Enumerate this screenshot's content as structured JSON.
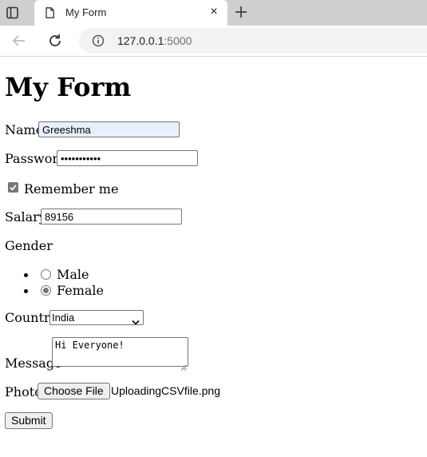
{
  "browser": {
    "tab_title": "My Form",
    "close_glyph": "×",
    "url_host": "127.0.0.1",
    "url_port": ":5000"
  },
  "form": {
    "heading": "My Form",
    "name_label": "Name",
    "name_value": "Greeshma",
    "password_label": "Password",
    "password_value": "•••••••••••",
    "remember_label": "Remember me",
    "remember_checked": true,
    "salary_label": "Salary",
    "salary_value": "89156",
    "gender_label": "Gender",
    "gender_options": [
      "Male",
      "Female"
    ],
    "gender_selected": "Female",
    "country_label": "Country",
    "country_value": "India",
    "message_label": "Message",
    "message_value": "Hi Everyone!",
    "photo_label": "Photo",
    "file_button_label": "Choose File",
    "file_name": "UploadingCSVfile.png",
    "submit_label": "Submit"
  },
  "icons": {
    "tab_strip": "tab-strip-icon",
    "document": "document-icon",
    "new_tab": "plus-icon",
    "back": "back-arrow-icon",
    "reload": "reload-icon",
    "info": "info-icon"
  }
}
